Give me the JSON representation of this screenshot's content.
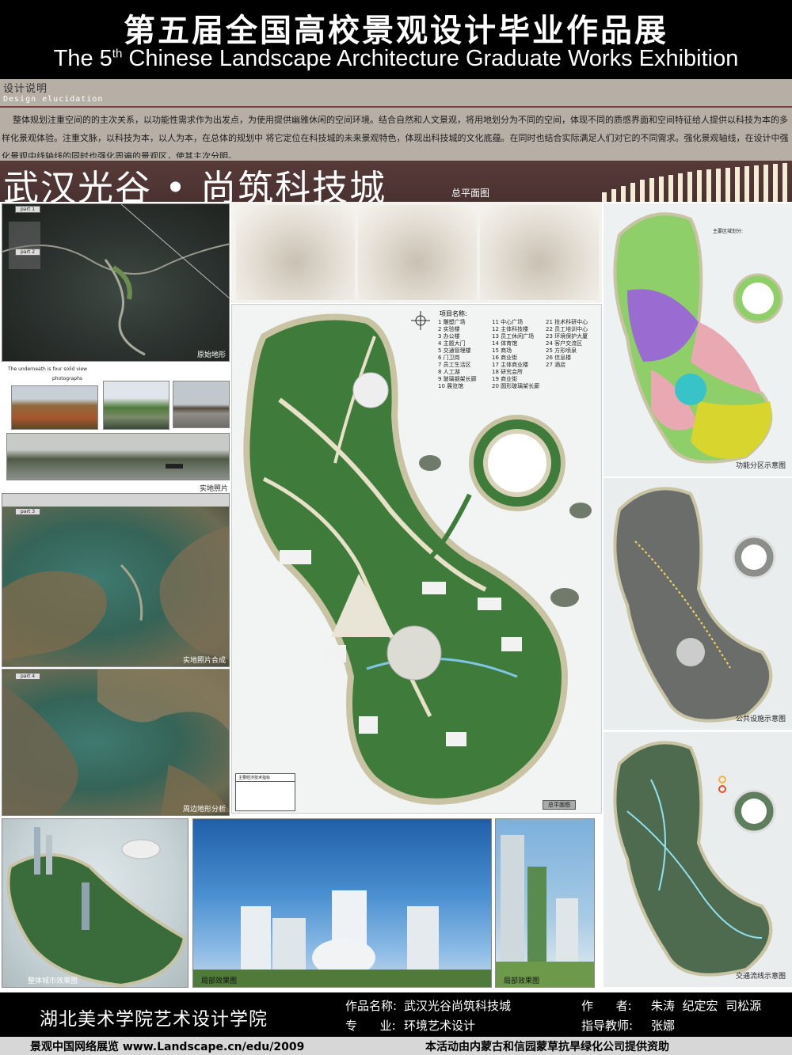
{
  "header": {
    "title_cn": "第五届全国高校景观设计毕业作品展",
    "title_en_pre": "The 5",
    "title_en_sup": "th",
    "title_en_post": " Chinese Landscape Architecture Graduate Works Exhibition"
  },
  "note": {
    "heading": "设计说明",
    "heading_en": "Design elucidation",
    "text": "整体规划注重空间的的主次关系，以功能性需求作为出发点，为使用提供幽雅休闲的空间环境。结合自然和人文景观，将用地划分为不同的空间，体现不同的质感界面和空间特征给人提供以科技为本的多样化景观体验。注重文脉，以科技为本，以人为本，在总体的规划中 将它定位在科技城的未来景观特色，体现出科技城的文化底蕴。在同时也结合实际满足人们对它的不同需求。强化景观轴线，在设计中强化景观中线轴线的同时也强化周遍的景观区，使其主次分明。"
  },
  "project": {
    "title": "武汉光谷 • 尚筑科技城",
    "subtitle": "总平面图"
  },
  "left_panels": {
    "original_terrain": "原始地形",
    "site_photo_heading": "The underneath is four solid view",
    "photographs_label": "photographs",
    "site_photos": "实地照片",
    "site_photo_composite": "实地照片合成",
    "surrounding_analysis": "周边地形分析",
    "parts": [
      "part 1",
      "part 2",
      "part 3",
      "part 4"
    ]
  },
  "legend": {
    "title": "项目名称:",
    "items": [
      "1 雕塑广场",
      "2 实验楼",
      "3 办公楼",
      "4 主题大门",
      "5 交通管理楼",
      "6 门卫岗",
      "7 员工生活区",
      "8 人工湖",
      "9 玻璃钢架长廊",
      "10 展览馆",
      "11 中心广场",
      "12 主体科技楼",
      "13 员工休闲广场",
      "14 体育馆",
      "15 商场",
      "16 商业街",
      "17 主体商业楼",
      "18 研究会所",
      "19 商业街",
      "20 圆形玻璃架长廊",
      "21 技术科研中心",
      "22 员工培训中心",
      "23 环境保护大厦",
      "24 客户交流区",
      "25 方形喷泉",
      "26 信息楼",
      "27 酒店"
    ],
    "plan_button": "总平面图",
    "econ_title": "主要经济技术指标"
  },
  "right_panels": {
    "zoning": "功能分区示意图",
    "zoning_legend_title": "主要区域划分:",
    "public_facilities": "公共设施示意图",
    "traffic_flow": "交通流线示意图"
  },
  "bottom_renders": {
    "overall": "整体城市效果图",
    "local_1": "局部效果图",
    "local_2": "局部效果图"
  },
  "footer": {
    "school": "湖北美术学院艺术设计学院",
    "work_name_label": "作品名称:",
    "work_name": "武汉光谷尚筑科技城",
    "author_label": "作      者:",
    "authors": "朱涛  纪定宏  司松源",
    "major_label": "专      业:",
    "major": "环境艺术设计",
    "advisor_label": "指导教师:",
    "advisor": "张娜",
    "site": "景观中国网络展览  www.Landscape.cn/edu/2009",
    "sponsor": "本活动由内蒙古和信园蒙草抗旱绿化公司提供资助"
  },
  "colors": {
    "band": "#4a3231",
    "note_bg": "#b7aea6",
    "plan_green": "#3f7b3a",
    "zone_purple": "#9a6bd0",
    "zone_yellow": "#d8d62e",
    "zone_pink": "#e8a9b3",
    "zone_cyan": "#37c3c7"
  }
}
